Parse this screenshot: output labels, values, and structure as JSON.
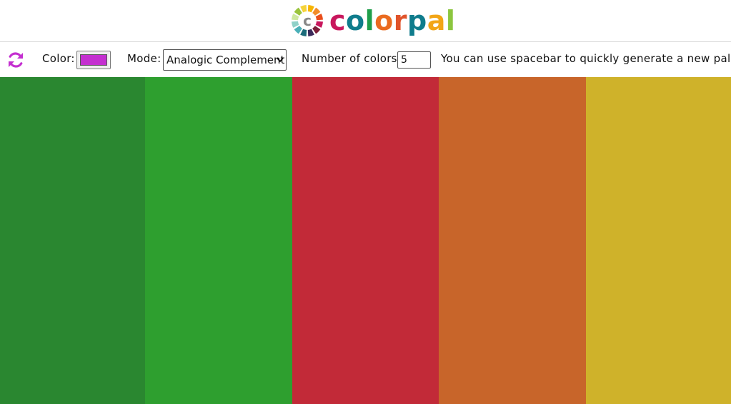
{
  "header": {
    "logo_letters": [
      {
        "ch": "c",
        "color": "#c8175d"
      },
      {
        "ch": "o",
        "color": "#0f7c8c"
      },
      {
        "ch": "l",
        "color": "#1f9e4a"
      },
      {
        "ch": "o",
        "color": "#ea6a1f"
      },
      {
        "ch": "r",
        "color": "#e0532a"
      },
      {
        "ch": "p",
        "color": "#0f7c8c"
      },
      {
        "ch": "a",
        "color": "#f2a516"
      },
      {
        "ch": "l",
        "color": "#8cc63f"
      }
    ],
    "logo_wheel_colors": [
      "#f7b500",
      "#f28c28",
      "#e94e1b",
      "#c8175d",
      "#7b1f3a",
      "#3a2a5a",
      "#1b6b7a",
      "#4ab0b8",
      "#8fd1c8",
      "#cfe8a0",
      "#9ac43c",
      "#f5d33a"
    ]
  },
  "toolbar": {
    "refresh_icon": "refresh-icon",
    "refresh_color": "#c42fd0",
    "color_label": "Color:",
    "color_value": "#c42fd0",
    "mode_label": "Mode:",
    "mode_value": "Analogic Complement",
    "count_label": "Number of colors:",
    "count_value": "5",
    "hint": "You can use spacebar to quickly generate a new palette!"
  },
  "palette": [
    "#2a8730",
    "#2e9f2f",
    "#c22a38",
    "#c8652a",
    "#cfb22a"
  ]
}
